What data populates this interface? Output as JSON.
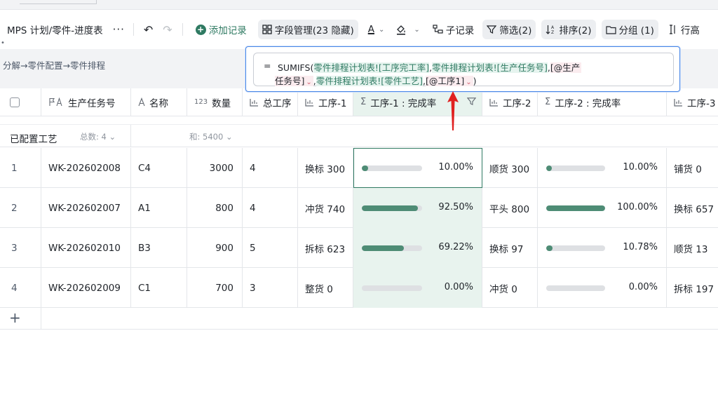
{
  "toolbar": {
    "title": "MPS 计划/零件-进度表",
    "more": "···",
    "add_record": "添加记录",
    "field_manage": "字段管理(23 隐藏)",
    "text_color_label": "A",
    "sub_record": "子记录",
    "filter": "筛选(2)",
    "sort": "排序(2)",
    "group": "分组 (1)",
    "row_height": "行高"
  },
  "breadcrumb": "分解→零件配置→零件排程",
  "formula": {
    "eq": "=",
    "fn": "SUMIFS(",
    "ref1": "零件排程计划表![工序完工率]",
    "c1": ",",
    "ref2": "零件排程计划表![生产任务号]",
    "c2": ",",
    "param1a": "[@生产",
    "param1b": "任务号]",
    "c3": ",",
    "ref3": "零件排程计划表![零件工艺]",
    "c4": ",",
    "param2": "[@工序1]",
    "close": ")"
  },
  "columns": [
    {
      "label": "生产任务号",
      "icon": "⚐ A"
    },
    {
      "label": "名称",
      "icon": "A"
    },
    {
      "label": "数量",
      "icon": "123"
    },
    {
      "label": "总工序",
      "icon": "lookup"
    },
    {
      "label": "工序-1",
      "icon": "lookup"
    },
    {
      "label": "工序-1 : 完成率",
      "icon": "Σ"
    },
    {
      "label": "工序-2",
      "icon": "lookup"
    },
    {
      "label": "工序-2 : 完成率",
      "icon": "Σ"
    },
    {
      "label": "工序-3",
      "icon": "lookup"
    }
  ],
  "group": {
    "name": "已配置工艺",
    "count": "总数:  4",
    "sum": "和: 5400"
  },
  "rows": [
    {
      "idx": "1",
      "task": "WK-202602008",
      "name": "C4",
      "qty": "3000",
      "total": "4",
      "p1": "换标 300",
      "r1": "10.00%",
      "r1v": 0.1,
      "p2": "顺货 300",
      "r2": "10.00%",
      "r2v": 0.1,
      "p3": "铺货 0"
    },
    {
      "idx": "2",
      "task": "WK-202602007",
      "name": "A1",
      "qty": "800",
      "total": "4",
      "p1": "冲货 740",
      "r1": "92.50%",
      "r1v": 0.925,
      "p2": "平头 800",
      "r2": "100.00%",
      "r2v": 1.0,
      "p3": "换标 657"
    },
    {
      "idx": "3",
      "task": "WK-202602010",
      "name": "B3",
      "qty": "900",
      "total": "5",
      "p1": "拆标 623",
      "r1": "69.22%",
      "r1v": 0.6922,
      "p2": "换标 97",
      "r2": "10.78%",
      "r2v": 0.1078,
      "p3": "顺货 13"
    },
    {
      "idx": "4",
      "task": "WK-202602009",
      "name": "C1",
      "qty": "700",
      "total": "3",
      "p1": "整货 0",
      "r1": "0.00%",
      "r1v": 0,
      "p2": "冲货 0",
      "r2": "0.00%",
      "r2v": 0,
      "p3": "拆标 197"
    }
  ],
  "colors": {
    "accent": "#2f7a62",
    "progress": "#4e8c75",
    "selected_col": "#e8f3ee",
    "formula_border": "#4b88e6",
    "arrow": "#e02020"
  }
}
